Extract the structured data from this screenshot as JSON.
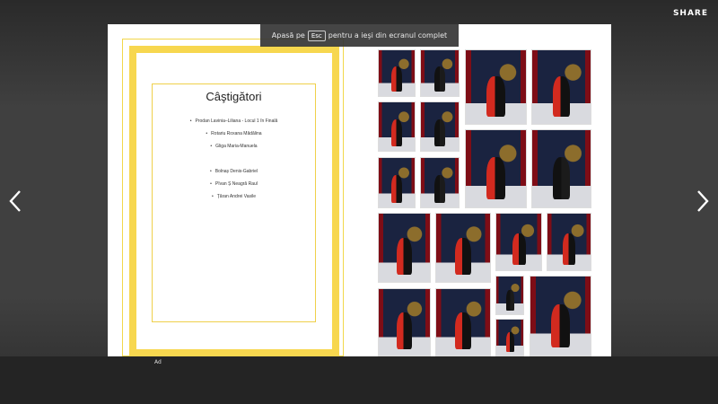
{
  "header": {
    "share_label": "SHARE"
  },
  "fullscreen_notice": {
    "prefix": "Apasă pe",
    "key": "Esc",
    "suffix": "pentru a ieşi din ecranul complet"
  },
  "left_page": {
    "title": "Câştigători",
    "winners": [
      "Prodan Lavinia–Liliana - Locul 1 în Finală",
      "Rotariu Roxana Mădălina",
      "Gliga Maria-Manuela",
      "Bolnaș Denis-Gabriel",
      "Pîvan Ș Neagră Raul",
      "Țăran Andrei Vasile"
    ]
  },
  "ad": {
    "label": "Ad"
  },
  "icons": {
    "prev": "chevron-left-icon",
    "next": "chevron-right-icon"
  },
  "colors": {
    "frame_yellow": "#f7d74f",
    "viewer_bg": "#404040"
  }
}
